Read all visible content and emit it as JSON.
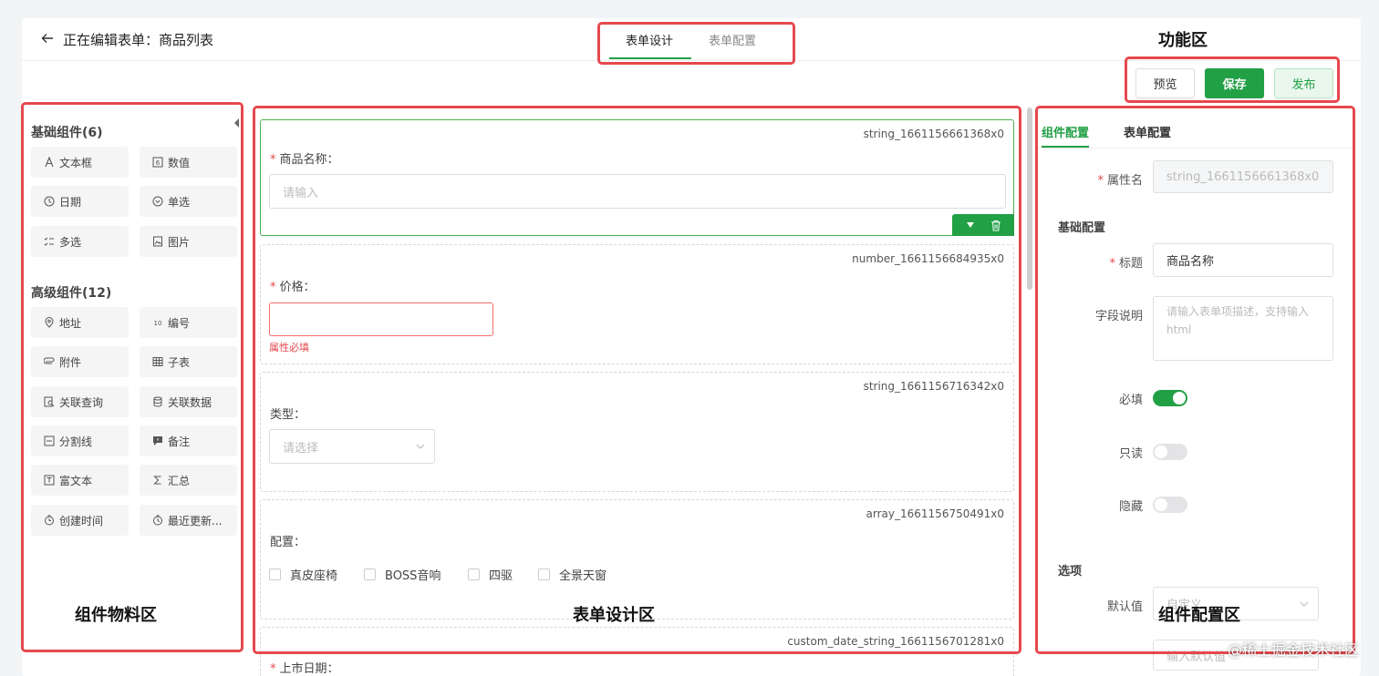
{
  "header": {
    "title": "正在编辑表单：商品列表",
    "tabs": [
      "表单设计",
      "表单配置"
    ],
    "buttons": {
      "preview": "预览",
      "save": "保存",
      "publish": "发布"
    }
  },
  "annotations": {
    "function_area": "功能区",
    "components_area": "组件物料区",
    "design_area": "表单设计区",
    "config_area": "组件配置区"
  },
  "sidebar": {
    "basic_title": "基础组件(6)",
    "basic": [
      {
        "label": "文本框",
        "icon": "text-icon"
      },
      {
        "label": "数值",
        "icon": "number-icon"
      },
      {
        "label": "日期",
        "icon": "clock-icon"
      },
      {
        "label": "单选",
        "icon": "radio-icon"
      },
      {
        "label": "多选",
        "icon": "checklist-icon"
      },
      {
        "label": "图片",
        "icon": "image-icon"
      }
    ],
    "advanced_title": "高级组件(12)",
    "advanced": [
      {
        "label": "地址",
        "icon": "location-icon"
      },
      {
        "label": "编号",
        "icon": "serial-icon"
      },
      {
        "label": "附件",
        "icon": "paperclip-icon"
      },
      {
        "label": "子表",
        "icon": "table-icon"
      },
      {
        "label": "关联查询",
        "icon": "search-doc-icon"
      },
      {
        "label": "关联数据",
        "icon": "database-icon"
      },
      {
        "label": "分割线",
        "icon": "divider-icon"
      },
      {
        "label": "备注",
        "icon": "comment-icon"
      },
      {
        "label": "富文本",
        "icon": "richtext-icon"
      },
      {
        "label": "汇总",
        "icon": "sigma-icon"
      },
      {
        "label": "创建时间",
        "icon": "create-time-icon"
      },
      {
        "label": "最近更新...",
        "icon": "update-time-icon"
      }
    ]
  },
  "form": {
    "fields": [
      {
        "id": "string_1661156661368x0",
        "label": "商品名称：",
        "required": true,
        "placeholder": "请输入"
      },
      {
        "id": "number_1661156684935x0",
        "label": "价格：",
        "required": true,
        "error": "属性必填"
      },
      {
        "id": "string_1661156716342x0",
        "label": "类型：",
        "required": false,
        "placeholder": "请选择"
      },
      {
        "id": "array_1661156750491x0",
        "label": "配置：",
        "required": false,
        "options": [
          "真皮座椅",
          "BOSS音响",
          "四驱",
          "全景天窗"
        ]
      },
      {
        "id": "custom_date_string_1661156701281x0",
        "label": "上市日期：",
        "required": true
      }
    ]
  },
  "config": {
    "tabs": [
      "组件配置",
      "表单配置"
    ],
    "attr_name_label": "属性名",
    "attr_name_value": "string_1661156661368x0",
    "basic_section": "基础配置",
    "title_label": "标题",
    "title_value": "商品名称",
    "desc_label": "字段说明",
    "desc_placeholder": "请输入表单项描述，支持输入html",
    "required_label": "必填",
    "readonly_label": "只读",
    "hidden_label": "隐藏",
    "options_section": "选项",
    "default_label": "默认值",
    "default_value": "自定义",
    "default_input_placeholder": "输入默认值",
    "toggles": {
      "required": true,
      "readonly": false,
      "hidden": false
    }
  },
  "watermark": "@稀土掘金技术社区",
  "colors": {
    "primary": "#22a046",
    "annotation_red": "#e5484d",
    "error": "#f56c6c"
  }
}
